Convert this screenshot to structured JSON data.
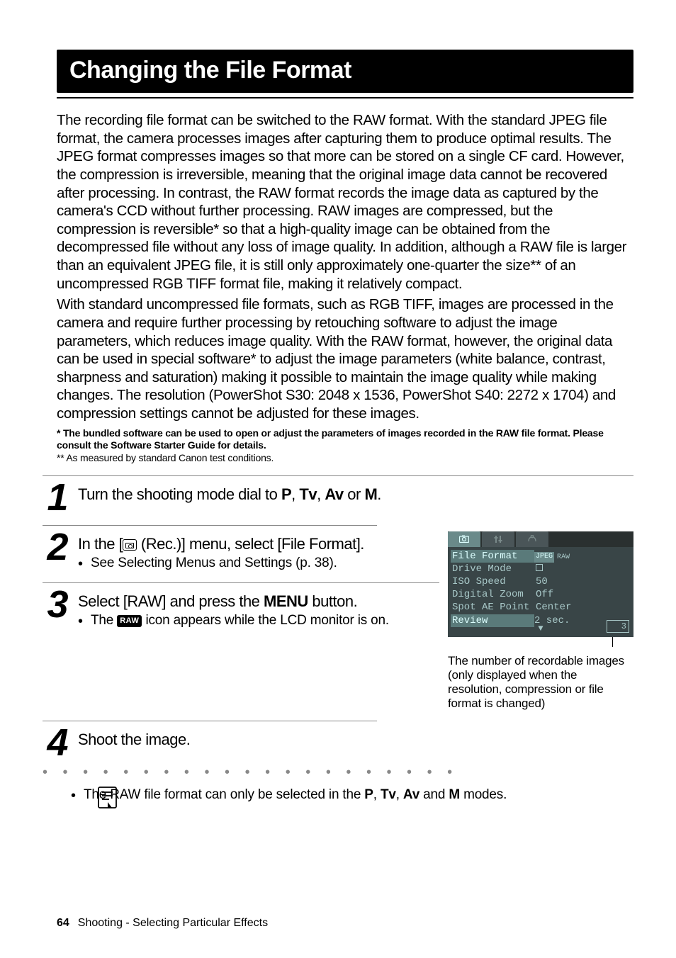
{
  "title": "Changing the File Format",
  "para1": "The recording file format can be switched to the RAW format. With the standard JPEG file format, the camera processes images after capturing them to produce optimal results. The JPEG format compresses images so that more can be stored on a single CF card. However, the compression is irreversible, meaning that the original image data cannot be recovered after processing. In contrast, the RAW format records the image data as captured by the camera's CCD without further processing. RAW images are compressed, but the compression is reversible* so that a high-quality image can be obtained from the decompressed file without any loss of image quality. In addition, although a RAW file is larger than an equivalent JPEG file, it is still only approximately one-quarter the size** of an uncompressed RGB TIFF format file, making it relatively compact.",
  "para2": "With standard uncompressed file formats, such as RGB TIFF, images are processed in the camera and require further processing by retouching software to adjust the image parameters, which reduces image quality. With the RAW format, however, the original data can be used in special software* to adjust the image parameters (white balance, contrast, sharpness and saturation) making it possible to maintain the image quality while making changes. The resolution (PowerShot S30: 2048 x 1536, PowerShot S40: 2272 x 1704) and compression settings cannot be adjusted for these images.",
  "note1": "*  The bundled software can be used to open or adjust the parameters of images recorded in the RAW file format. Please consult the Software Starter Guide for details.",
  "note2": "** As measured by standard Canon test conditions.",
  "step1": {
    "pre": "Turn the shooting mode dial to ",
    "modes": [
      "P",
      "Tv",
      "Av",
      "M"
    ],
    "post": "."
  },
  "step2": {
    "heading_pre": "In the [",
    "heading_post": " (Rec.)] menu, select [File Format].",
    "bullet": "See Selecting Menus and Settings (p. 38)."
  },
  "step3": {
    "heading_pre": "Select [RAW] and press the ",
    "menu": "MENU",
    "heading_post": " button.",
    "bullet_pre": "The ",
    "bullet_raw": "RAW",
    "bullet_post": " icon appears while the LCD monitor is on."
  },
  "step4": {
    "heading": "Shoot the image."
  },
  "tip": {
    "pre": "The RAW file format can only be selected in the ",
    "modes": [
      "P",
      "Tv",
      "Av",
      "M"
    ],
    "post": " modes."
  },
  "lcd": {
    "rows": [
      {
        "label": "File Format",
        "val": "JPEG RAW",
        "sel": true
      },
      {
        "label": "Drive Mode",
        "val": "square"
      },
      {
        "label": "ISO Speed",
        "val": "50"
      },
      {
        "label": "Digital Zoom",
        "val": "Off"
      },
      {
        "label": "Spot AE Point",
        "val": "Center"
      },
      {
        "label": "Review",
        "val": "2 sec."
      }
    ],
    "counter": "3"
  },
  "caption": "The number of recordable images (only displayed when the resolution, compression or file format is changed)",
  "footer": {
    "page": "64",
    "section": "Shooting - Selecting Particular Effects"
  }
}
